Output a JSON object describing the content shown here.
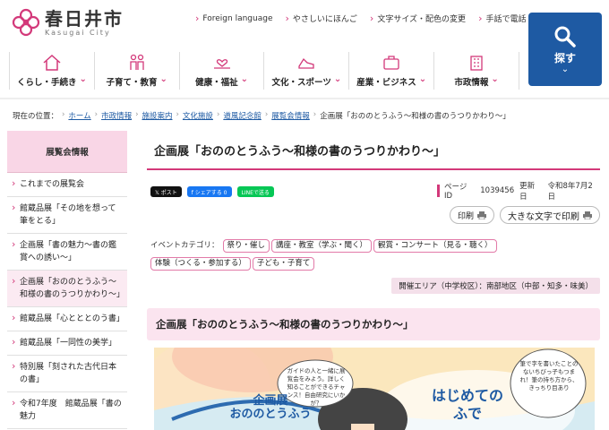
{
  "header": {
    "logo_title": "春日井市",
    "logo_sub": "Kasugai City",
    "util_links": [
      "Foreign language",
      "やさしいにほんご",
      "文字サイズ・配色の変更",
      "手話で電話"
    ],
    "search_label": "探す",
    "nav": [
      {
        "label": "くらし・手続き",
        "icon": "house-icon"
      },
      {
        "label": "子育て・教育",
        "icon": "family-icon"
      },
      {
        "label": "健康・福祉",
        "icon": "heart-hand-icon"
      },
      {
        "label": "文化・スポーツ",
        "icon": "shoe-icon"
      },
      {
        "label": "産業・ビジネス",
        "icon": "briefcase-icon"
      },
      {
        "label": "市政情報",
        "icon": "building-icon"
      }
    ]
  },
  "breadcrumb": {
    "prefix": "現在の位置：",
    "items": [
      "ホーム",
      "市政情報",
      "施設案内",
      "文化施設",
      "道風記念館",
      "展覧会情報"
    ],
    "current": "企画展「おののとうふう～和様の書のうつりかわり～」"
  },
  "sidebar": {
    "heading": "展覧会情報",
    "items": [
      "これまでの展覧会",
      "館蔵品展「その地を想って筆をとる」",
      "企画展「書の魅力～書の鑑賞への誘い～」",
      "企画展「おののとうふう～和様の書のうつりかわり～」",
      "館蔵品展「心とととのう書」",
      "館蔵品展「一同性の美学」",
      "特別展「刻された古代日本の書」",
      "令和7年度　館蔵品展「書の魅力"
    ]
  },
  "main": {
    "title": "企画展「おののとうふう～和様の書のうつりかわり～」",
    "share": {
      "x": "𝕏 ポスト",
      "fb": "f シェアする 0",
      "line": "LINEで送る"
    },
    "page_id_label": "ページID",
    "page_id": "1039456",
    "updated_label": "更新日",
    "updated": "令和8年7月2日",
    "print_label": "印刷",
    "big_print_label": "大きな文字で印刷",
    "category_label": "イベントカテゴリ：",
    "tags": [
      "祭り・催し",
      "講座・教室（学ぶ・聞く）",
      "観賞・コンサート（見る・聴く）",
      "体験（つくる・参加する）",
      "子ども・子育て"
    ],
    "area": "開催エリア（中学校区）：南部地区（中部・知多・味美）",
    "sub_title": "企画展「おののとうふう～和様の書のうつりかわり～」",
    "poster": {
      "headline_1": "企画展",
      "headline_2": "おののとうふう",
      "bubble_1": "ガイドの人と一緒に展覧会をみよう。詳しく知ることができるチャンス！自由研究にいかが？",
      "bubble_2_line_1": "はじめての",
      "bubble_2_line_2": "ふで",
      "bubble_3": "筆で字を書いたことのないちびっ子もつまれ！筆の持ち方から、きっちり目あり"
    }
  },
  "colors": {
    "accent": "#d3397a",
    "brand_blue": "#1e5aa3",
    "pink_light": "#fbe4ef"
  }
}
